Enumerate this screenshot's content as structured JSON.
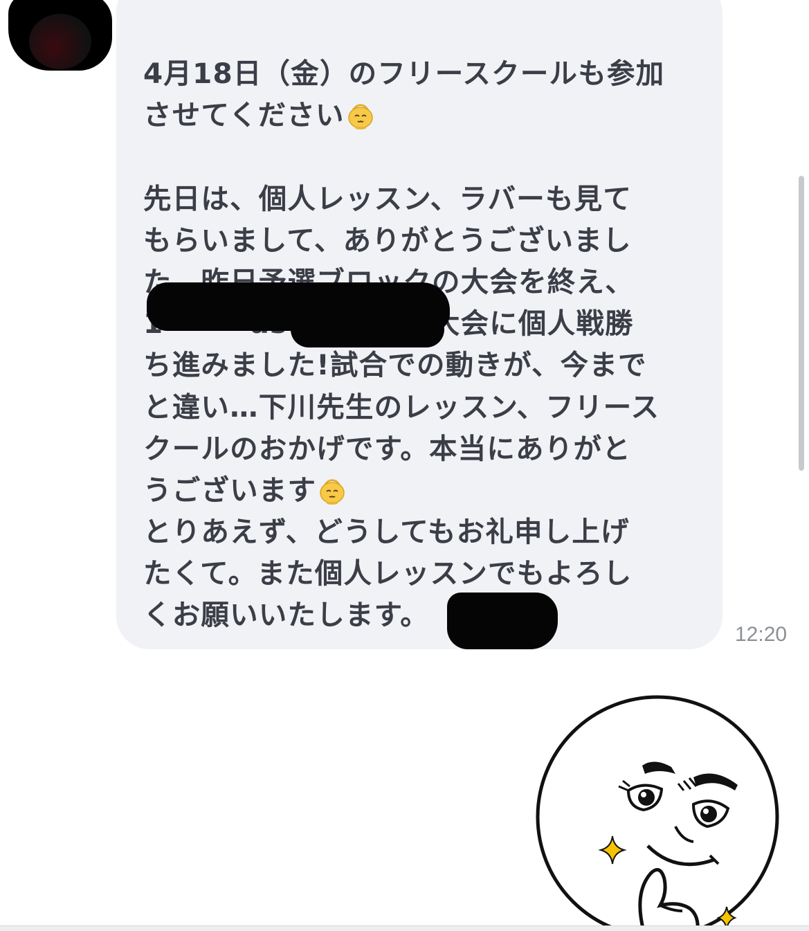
{
  "chat": {
    "sender_name": "",
    "message_lines": [
      "4月18日（金）のフリースクールも参加",
      "させてください",
      "",
      "先日は、個人レッスン、ラバーも見て",
      "もらいまして、ありがとうございまし",
      "た。昨日予選ブロックの大会を終え、",
      "1　　　as　　　　の大会に個人戦勝",
      "ち進みました!試合での動きが、今まで",
      "と違い…下川先生のレッスン、フリース",
      "クールのおかげです。本当にありがと",
      "うございます",
      "とりあえず、どうしてもお礼申し上げ",
      "たくて。また個人レッスンでもよろし",
      "くお願いいたします。"
    ],
    "timestamp": "12:20"
  },
  "colors": {
    "bubble_bg": "#f1f2f6",
    "text": "#3b3e47",
    "timestamp": "#8c8f96",
    "redaction": "#050505",
    "scrollbar": "#c8c9cc"
  },
  "icons": {
    "emoji": "bowing-face-emoji",
    "sticker": "smug-moon-face-sticker"
  }
}
